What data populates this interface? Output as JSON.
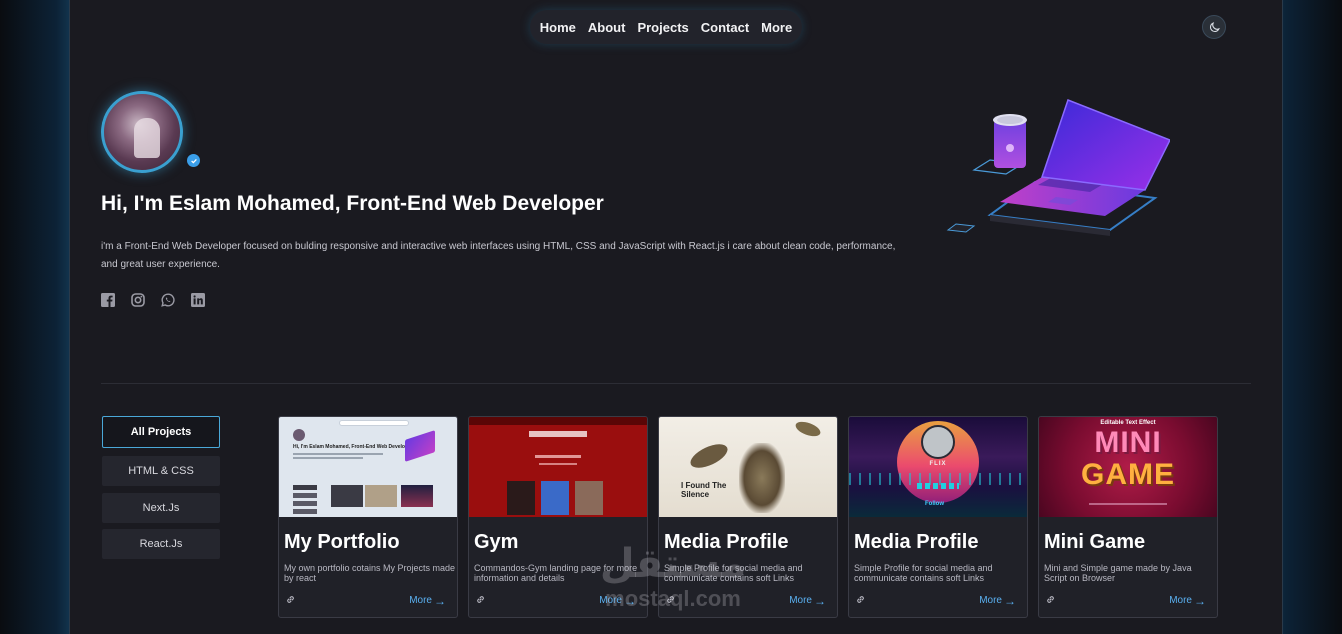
{
  "nav": {
    "items": [
      "Home",
      "About",
      "Projects",
      "Contact",
      "More"
    ]
  },
  "theme_toggle": {
    "icon": "moon-icon"
  },
  "hero": {
    "title": "Hi, I'm Eslam Mohamed, Front-End Web Developer",
    "description": "i'm a Front-End Web Developer focused on bulding responsive and interactive web interfaces using HTML, CSS and JavaScript with React.js i care about clean code, performance, and great user experience.",
    "socials": [
      "facebook-icon",
      "instagram-icon",
      "whatsapp-icon",
      "linkedin-icon"
    ]
  },
  "filters": [
    "All Projects",
    "HTML & CSS",
    "Next.Js",
    "React.Js"
  ],
  "projects": [
    {
      "title": "My Portfolio",
      "description": "My own portfolio cotains My Projects made by react",
      "more": "More"
    },
    {
      "title": "Gym",
      "description": "Commandos-Gym landing page for more information and details",
      "more": "More"
    },
    {
      "title": "Media Profile",
      "description": "Simple Profile for social media and communicate contains soft Links",
      "more": "More"
    },
    {
      "title": "Media Profile",
      "description": "Simple Profile for social media and communicate contains soft Links",
      "more": "More"
    },
    {
      "title": "Mini Game",
      "description": "Mini and Simple game made by Java Script on Browser",
      "more": "More"
    }
  ],
  "thumbnails": {
    "portfolio_heading": "Hi, I'm Eslam Mohamed, Front-End Web Developer",
    "silence_text": "I Found The Silence",
    "flix_text": "FLIX",
    "follow_text": "Follow",
    "minigame_top": "Editable Text Effect",
    "minigame_line1": "MINI",
    "minigame_line2": "GAME"
  },
  "watermark": {
    "arabic": "مستقل",
    "latin": "mostaql.com"
  },
  "colors": {
    "accent": "#4aa8d8",
    "link": "#5ab0f0",
    "page_bg": "#1a1a20",
    "card_bg": "#202128"
  }
}
